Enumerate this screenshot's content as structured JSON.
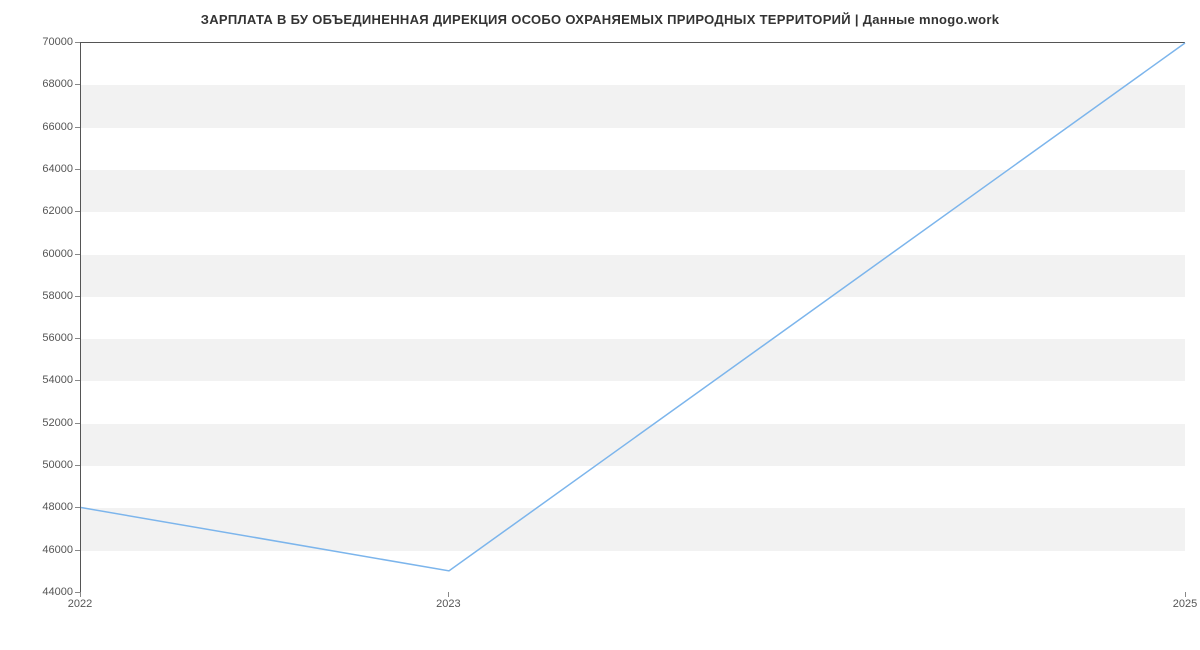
{
  "chart_data": {
    "type": "line",
    "title": "ЗАРПЛАТА В БУ ОБЪЕДИНЕННАЯ ДИРЕКЦИЯ ОСОБО ОХРАНЯЕМЫХ ПРИРОДНЫХ ТЕРРИТОРИЙ | Данные mnogo.work",
    "x": [
      2022,
      2023,
      2025
    ],
    "y": [
      48000,
      45000,
      70000
    ],
    "xlabel": "",
    "ylabel": "",
    "x_ticks": [
      2022,
      2023,
      2025
    ],
    "y_ticks": [
      44000,
      46000,
      48000,
      50000,
      52000,
      54000,
      56000,
      58000,
      60000,
      62000,
      64000,
      66000,
      68000,
      70000
    ],
    "xlim": [
      2022,
      2025
    ],
    "ylim": [
      44000,
      70000
    ],
    "line_color": "#7cb5ec"
  }
}
